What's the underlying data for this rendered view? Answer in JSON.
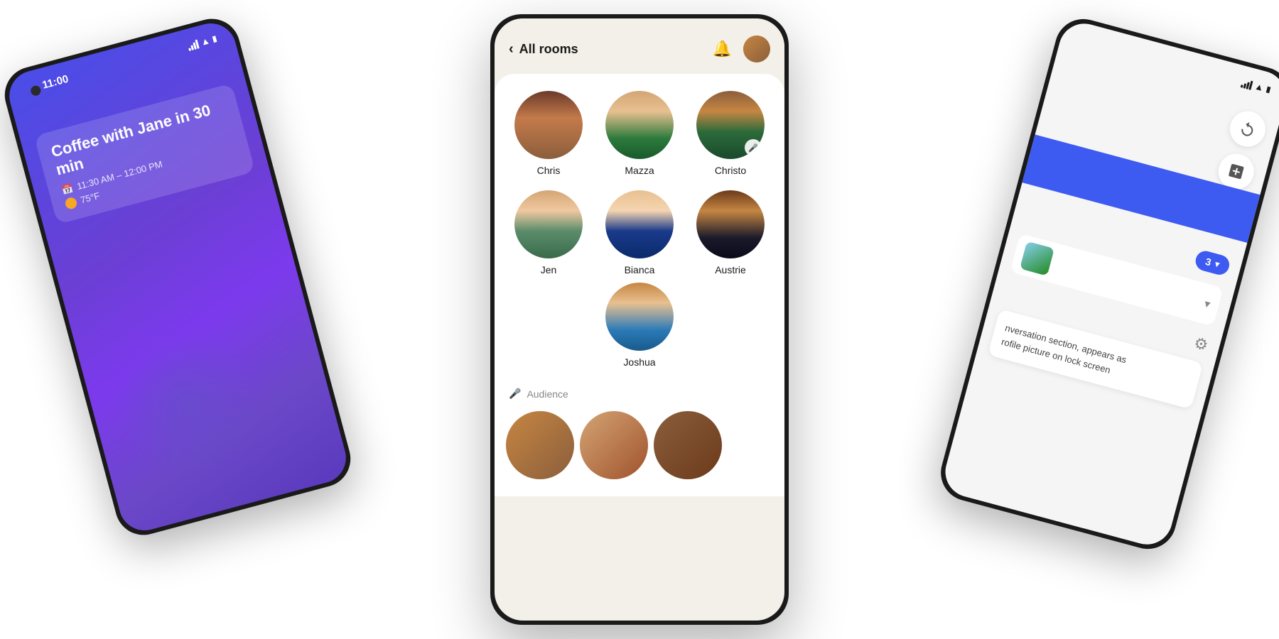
{
  "scene": {
    "background": "#ffffff"
  },
  "phone_left": {
    "time": "11:00",
    "notification": {
      "title": "Coffee with Jane in 30 min",
      "time_range": "11:30 AM – 12:00 PM",
      "weather": "75°F"
    }
  },
  "phone_center": {
    "header": {
      "back_label": "All rooms",
      "back_icon": "chevron-left"
    },
    "contacts": [
      {
        "name": "Chris",
        "row": 1,
        "col": 1,
        "muted": false
      },
      {
        "name": "Mazza",
        "row": 1,
        "col": 2,
        "muted": false
      },
      {
        "name": "Christo",
        "row": 1,
        "col": 3,
        "muted": true
      },
      {
        "name": "Jen",
        "row": 2,
        "col": 1,
        "muted": false
      },
      {
        "name": "Bianca",
        "row": 2,
        "col": 2,
        "muted": false
      },
      {
        "name": "Austrie",
        "row": 2,
        "col": 3,
        "muted": false
      },
      {
        "name": "Joshua",
        "row": 3,
        "col": 1,
        "muted": false
      }
    ],
    "audience_label": "Audience"
  },
  "phone_right": {
    "badge_count": "3",
    "text_preview": "nversation section, appears as\nrofile picture on lock screen",
    "gear_icon": "gear"
  }
}
